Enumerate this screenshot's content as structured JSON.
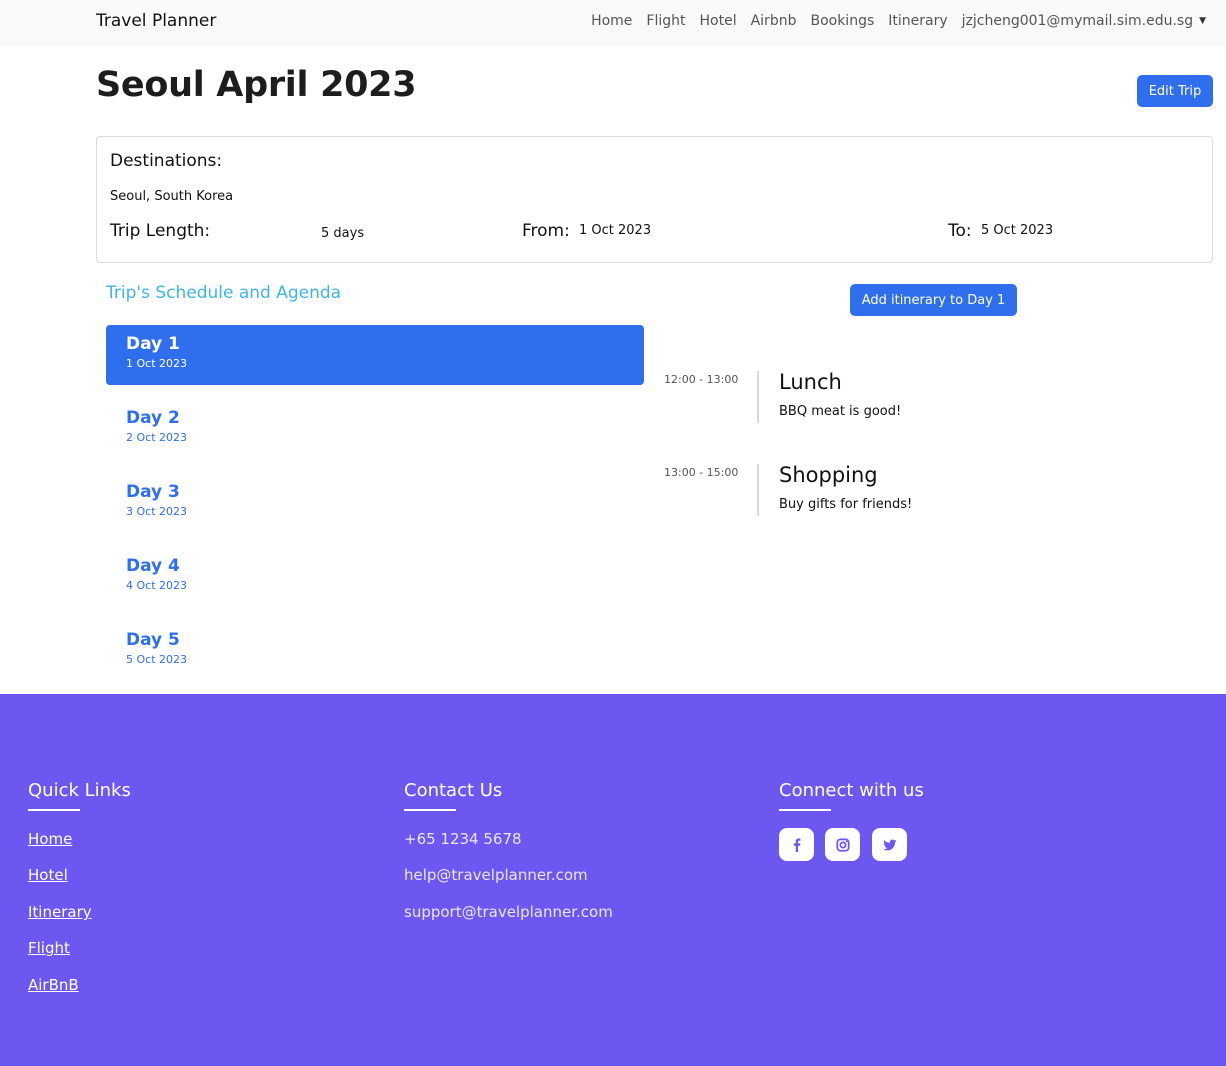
{
  "navbar": {
    "brand": "Travel Planner",
    "links": [
      "Home",
      "Flight",
      "Hotel",
      "Airbnb",
      "Bookings",
      "Itinerary"
    ],
    "user_email": "jzjcheng001@mymail.sim.edu.sg"
  },
  "trip": {
    "title": "Seoul April 2023",
    "edit_label": "Edit Trip",
    "destinations_label": "Destinations:",
    "destinations_value": "Seoul, South Korea",
    "length_label": "Trip Length:",
    "length_value": "5 days",
    "from_label": "From:",
    "from_value": "1 Oct 2023",
    "to_label": "To:",
    "to_value": "5 Oct 2023"
  },
  "schedule": {
    "title": "Trip's Schedule and Agenda",
    "add_label": "Add itinerary to Day 1",
    "days": [
      {
        "name": "Day 1",
        "date": "1 Oct 2023"
      },
      {
        "name": "Day 2",
        "date": "2 Oct 2023"
      },
      {
        "name": "Day 3",
        "date": "3 Oct 2023"
      },
      {
        "name": "Day 4",
        "date": "4 Oct 2023"
      },
      {
        "name": "Day 5",
        "date": "5 Oct 2023"
      }
    ],
    "events": [
      {
        "time": "12:00 - 13:00",
        "title": "Lunch",
        "desc": "BBQ meat is good!"
      },
      {
        "time": "13:00 - 15:00",
        "title": "Shopping",
        "desc": "Buy gifts for friends!"
      }
    ]
  },
  "footer": {
    "quick_links_title": "Quick Links",
    "quick_links": [
      "Home",
      "Hotel",
      "Itinerary",
      "Flight",
      "AirBnB"
    ],
    "contact_title": "Contact Us",
    "contact": [
      "+65 1234 5678",
      "help@travelplanner.com",
      "support@travelplanner.com"
    ],
    "connect_title": "Connect with us",
    "social_icons": [
      "facebook-icon",
      "instagram-icon",
      "twitter-icon"
    ]
  },
  "colors": {
    "primary": "#2f6fed",
    "footer_bg": "#6c57f1",
    "schedule_title": "#3fb5e6"
  }
}
